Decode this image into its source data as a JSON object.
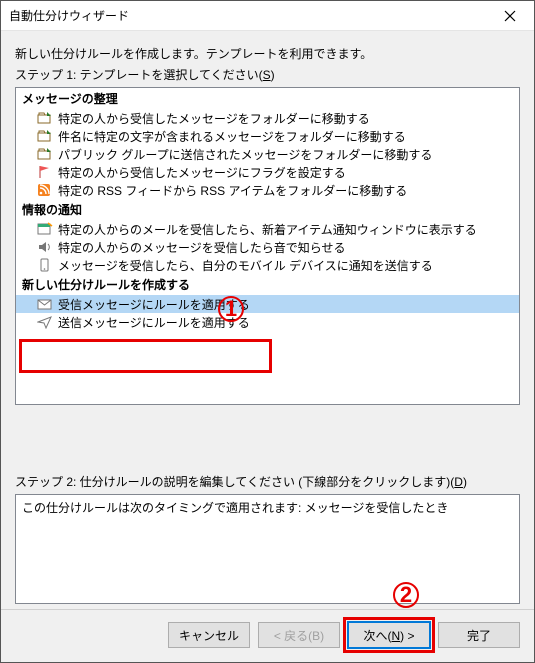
{
  "window": {
    "title": "自動仕分けウィザード"
  },
  "step1": {
    "instr_create": "新しい仕分けルールを作成します。テンプレートを利用できます。",
    "instr_select": "ステップ 1: テンプレートを選択してください(",
    "instr_select_u": "S",
    "instr_select_end": ")"
  },
  "groups": {
    "g1": {
      "header": "メッセージの整理",
      "items": [
        "特定の人から受信したメッセージをフォルダーに移動する",
        "件名に特定の文字が含まれるメッセージをフォルダーに移動する",
        "パブリック グループに送信されたメッセージをフォルダーに移動する",
        "特定の人から受信したメッセージにフラグを設定する",
        "特定の RSS フィードから RSS アイテムをフォルダーに移動する"
      ]
    },
    "g2": {
      "header": "情報の通知",
      "items": [
        "特定の人からのメールを受信したら、新着アイテム通知ウィンドウに表示する",
        "特定の人からのメッセージを受信したら音で知らせる",
        "メッセージを受信したら、自分のモバイル デバイスに通知を送信する"
      ]
    },
    "g3": {
      "header": "新しい仕分けルールを作成する",
      "items": [
        "受信メッセージにルールを適用する",
        "送信メッセージにルールを適用する"
      ]
    }
  },
  "step2": {
    "label_pre": "ステップ 2: 仕分けルールの説明を編集してください (下線部分をクリックします)(",
    "label_u": "D",
    "label_end": ")",
    "desc": "この仕分けルールは次のタイミングで適用されます: メッセージを受信したとき"
  },
  "buttons": {
    "cancel": "キャンセル",
    "back": "< 戻る(B)",
    "next_pre": "次へ(",
    "next_u": "N",
    "next_end": ") >",
    "finish": "完了"
  },
  "callouts": {
    "one": "1",
    "two": "2"
  }
}
